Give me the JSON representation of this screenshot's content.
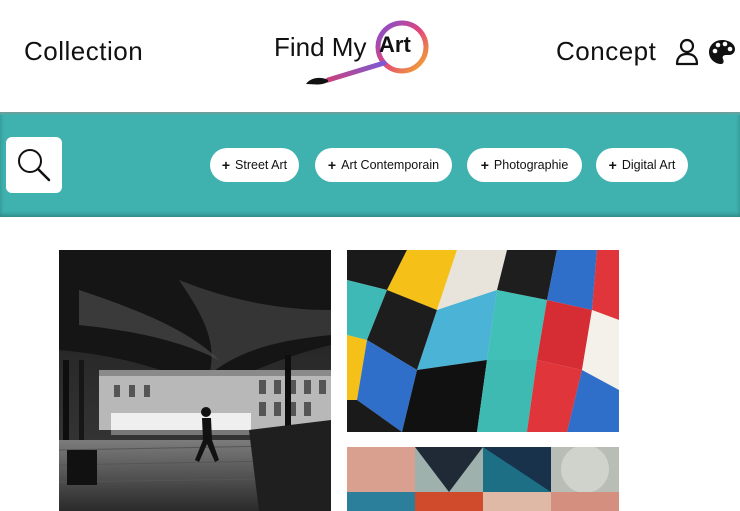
{
  "header": {
    "nav_left": "Collection",
    "nav_right": "Concept",
    "logo_text": "Find My",
    "logo_art": "Art",
    "icons": [
      "user-icon",
      "palette-icon"
    ]
  },
  "filters": {
    "search_icon": "search-icon",
    "chips": [
      {
        "plus": "+",
        "label": "Street Art"
      },
      {
        "plus": "+",
        "label": "Art Contemporain"
      },
      {
        "plus": "+",
        "label": "Photographie"
      },
      {
        "plus": "+",
        "label": "Digital Art"
      }
    ]
  },
  "gallery": {
    "tiles": [
      "black-and-white-venice-photo",
      "colorful-abstract-mural",
      "geometric-shapes-artwork"
    ]
  },
  "colors": {
    "accent": "#3fb1ae",
    "background": "#ffffff",
    "chip_bg": "#ffffff",
    "text": "#111111"
  }
}
